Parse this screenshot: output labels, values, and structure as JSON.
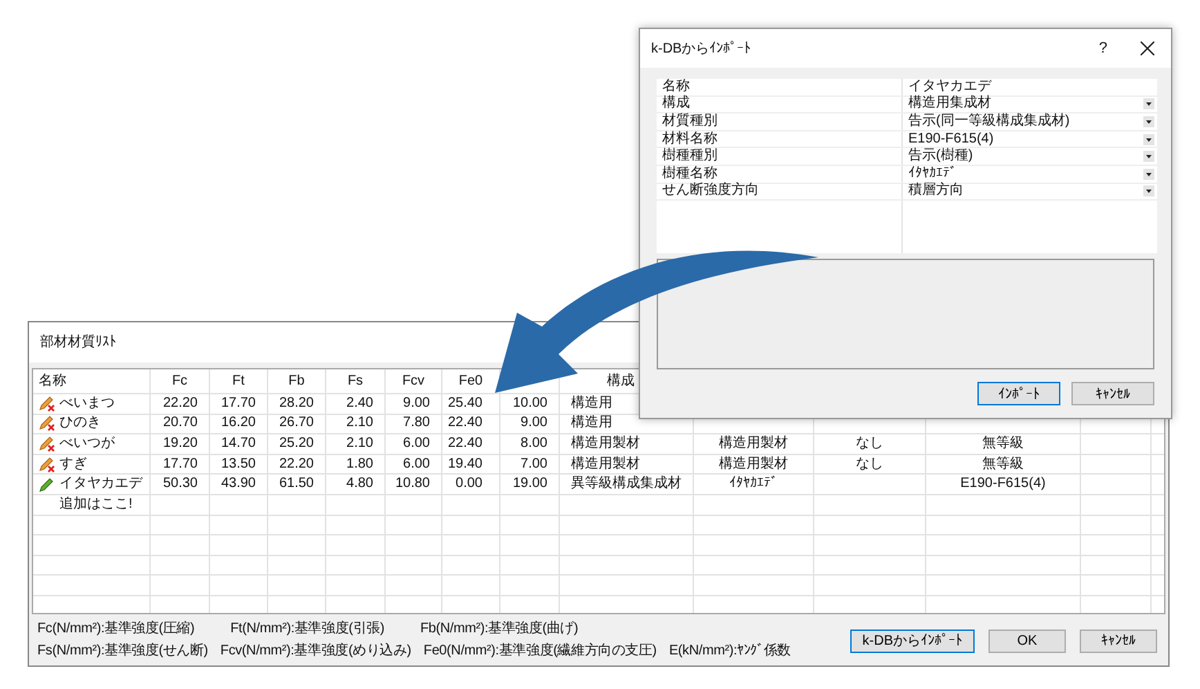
{
  "main_window": {
    "title": "部材材質ﾘｽﾄ",
    "table": {
      "columns": [
        "名称",
        "Fc",
        "Ft",
        "Fb",
        "Fs",
        "Fcv",
        "Fe0",
        null,
        "構成",
        null,
        null,
        null,
        null
      ],
      "rows": [
        {
          "kind": "standard",
          "cells": [
            "べいまつ",
            "22.20",
            "17.70",
            "28.20",
            "2.40",
            "9.00",
            "25.40",
            "10.00",
            "構造用",
            null,
            null,
            null,
            null
          ]
        },
        {
          "kind": "standard",
          "cells": [
            "ひのき",
            "20.70",
            "16.20",
            "26.70",
            "2.10",
            "7.80",
            "22.40",
            "9.00",
            "構造用",
            null,
            null,
            null,
            null
          ]
        },
        {
          "kind": "standard",
          "cells": [
            "べいつが",
            "19.20",
            "14.70",
            "25.20",
            "2.10",
            "6.00",
            "22.40",
            "8.00",
            "構造用製材",
            "構造用製材",
            "なし",
            "無等級",
            null
          ]
        },
        {
          "kind": "standard",
          "cells": [
            "すぎ",
            "17.70",
            "13.50",
            "22.20",
            "1.80",
            "6.00",
            "19.40",
            "7.00",
            "構造用製材",
            "構造用製材",
            "なし",
            "無等級",
            null
          ]
        },
        {
          "kind": "custom",
          "cells": [
            "イタヤカエデ",
            "50.30",
            "43.90",
            "61.50",
            "4.80",
            "10.80",
            "0.00",
            "19.00",
            "異等級構成集成材",
            "ｲﾀﾔｶｴﾃﾞ",
            null,
            "E190-F615(4)",
            null
          ]
        },
        {
          "kind": "add",
          "cells": [
            "追加はここ!",
            null,
            null,
            null,
            null,
            null,
            null,
            null,
            null,
            null,
            null,
            null,
            null
          ]
        }
      ]
    },
    "legend": [
      [
        "Fc(N/mm²):基準強度(圧縮)",
        "Ft(N/mm²):基準強度(引張)",
        "Fb(N/mm²):基準強度(曲げ)"
      ],
      [
        "Fs(N/mm²):基準強度(せん断)",
        "Fcv(N/mm²):基準強度(めり込み)",
        "Fe0(N/mm²):基準強度(繊維方向の支圧)",
        "E(kN/mm²):ﾔﾝｸﾞ係数"
      ]
    ],
    "buttons": [
      "k-DBからｲﾝﾎﾟｰﾄ",
      "OK",
      "ｷｬﾝｾﾙ"
    ]
  },
  "dialog": {
    "title": "k-DBからｲﾝﾎﾟｰﾄ",
    "help": "?",
    "properties": [
      {
        "label": "名称",
        "value": "イタヤカエデ",
        "dropdown": false
      },
      {
        "label": "構成",
        "value": "構造用集成材",
        "dropdown": true
      },
      {
        "label": "材質種別",
        "value": "告示(同一等級構成集成材)",
        "dropdown": true
      },
      {
        "label": "材料名称",
        "value": "E190-F615(4)",
        "dropdown": true
      },
      {
        "label": "樹種種別",
        "value": "告示(樹種)",
        "dropdown": true
      },
      {
        "label": "樹種名称",
        "value": "ｲﾀﾔｶｴﾃﾞ",
        "dropdown": true
      },
      {
        "label": "せん断強度方向",
        "value": "積層方向",
        "dropdown": true
      }
    ],
    "buttons": [
      "ｲﾝﾎﾟｰﾄ",
      "ｷｬﾝｾﾙ"
    ]
  }
}
